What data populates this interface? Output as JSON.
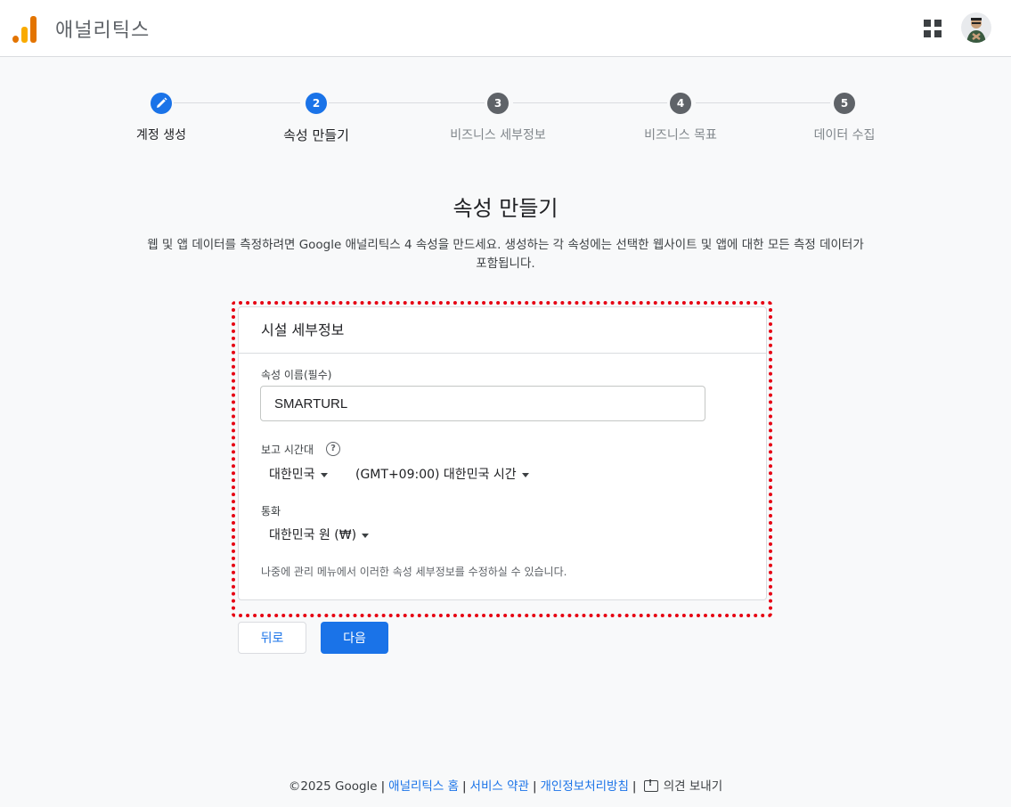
{
  "header": {
    "title": "애널리틱스"
  },
  "stepper": {
    "steps": [
      {
        "number": "",
        "label": "계정 생성",
        "state": "done"
      },
      {
        "number": "2",
        "label": "속성 만들기",
        "state": "active"
      },
      {
        "number": "3",
        "label": "비즈니스 세부정보",
        "state": "todo"
      },
      {
        "number": "4",
        "label": "비즈니스 목표",
        "state": "todo"
      },
      {
        "number": "5",
        "label": "데이터 수집",
        "state": "todo"
      }
    ]
  },
  "page": {
    "title": "속성 만들기",
    "description": "웹 및 앱 데이터를 측정하려면 Google 애널리틱스 4 속성을 만드세요. 생성하는 각 속성에는 선택한 웹사이트 및 앱에 대한 모든 측정 데이터가 포함됩니다."
  },
  "card": {
    "title": "시설 세부정보",
    "property_name_label": "속성 이름(필수)",
    "property_name_value": "SMARTURL",
    "timezone_label": "보고 시간대",
    "timezone_country": "대한민국",
    "timezone_value": "(GMT+09:00) 대한민국 시간",
    "currency_label": "통화",
    "currency_value": "대한민국 원 (₩)",
    "note": "나중에 관리 메뉴에서 이러한 속성 세부정보를 수정하실 수 있습니다."
  },
  "buttons": {
    "back": "뒤로",
    "next": "다음"
  },
  "footer": {
    "copyright": "©2025 Google",
    "link_home": "애널리틱스 홈",
    "link_terms": "서비스 약관",
    "link_privacy": "개인정보처리방침",
    "feedback": "의견 보내기"
  },
  "colors": {
    "accent": "#1a73e8",
    "highlight": "#e60012",
    "logo_dark": "#e37400",
    "logo_light": "#f9ab00"
  }
}
